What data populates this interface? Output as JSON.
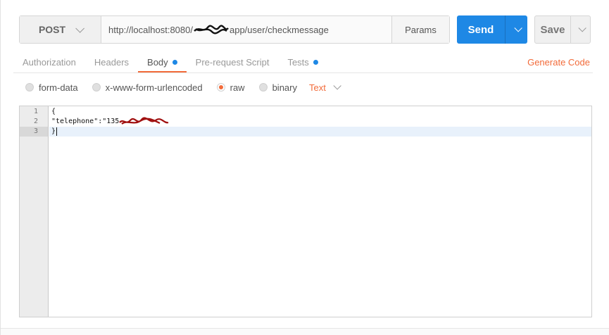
{
  "request": {
    "method": "POST",
    "url_start": "http://localhost:8080/",
    "url_end": "app/user/checkmessage",
    "params_label": "Params"
  },
  "buttons": {
    "send": "Send",
    "save": "Save"
  },
  "tabs": [
    {
      "label": "Authorization"
    },
    {
      "label": "Headers"
    },
    {
      "label": "Body"
    },
    {
      "label": "Pre-request Script"
    },
    {
      "label": "Tests"
    }
  ],
  "generate_code": "Generate Code",
  "body_modes": [
    {
      "label": "form-data"
    },
    {
      "label": "x-www-form-urlencoded"
    },
    {
      "label": "raw"
    },
    {
      "label": "binary"
    }
  ],
  "content_type": "Text",
  "editor": {
    "line_numbers": [
      "1",
      "2",
      "3"
    ],
    "lines": [
      "{",
      "\"telephone\":\"135",
      "}"
    ]
  },
  "colors": {
    "accent": "#f26b3a",
    "send": "#1e88e5",
    "redaction_url": "#111111",
    "redaction_code": "#a01010"
  }
}
